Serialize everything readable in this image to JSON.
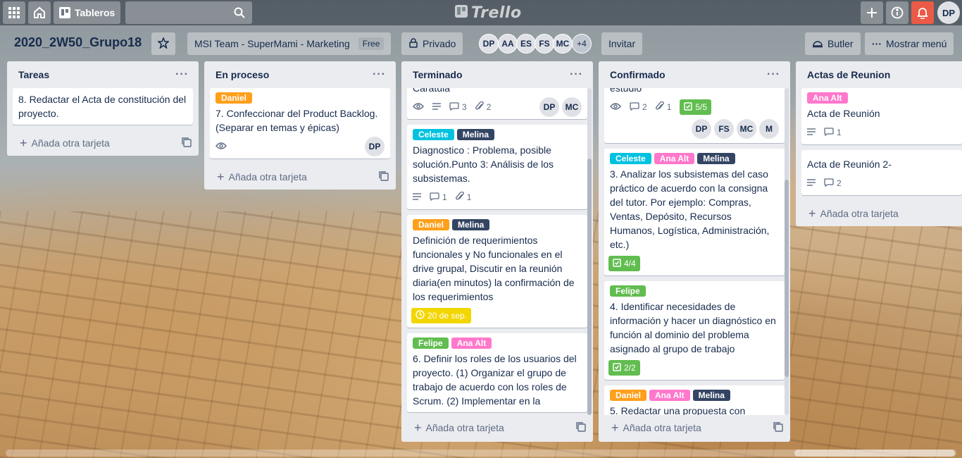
{
  "topbar": {
    "boards_label": "Tableros",
    "logo": "Trello",
    "user_initials": "DP"
  },
  "board": {
    "title": "2020_2W50_Grupo18",
    "team": "MSI Team - SuperMami - Marketing",
    "team_badge": "Free",
    "visibility": "Privado",
    "members": [
      "DP",
      "AA",
      "ES",
      "FS",
      "MC"
    ],
    "members_more": "+4",
    "invite_label": "Invitar",
    "butler_label": "Butler",
    "show_menu_label": "Mostrar menú"
  },
  "label_colors": {
    "Daniel": "#ff9f1a",
    "Celeste": "#00c2e0",
    "Melina": "#344563",
    "Ana Alt": "#ff78cb",
    "Felipe": "#61bd4f"
  },
  "add_card_label": "Añada otra tarjeta",
  "lists": [
    {
      "title": "Tareas",
      "cards": [
        {
          "text": "8. Redactar el Acta de constitución del proyecto."
        }
      ]
    },
    {
      "title": "En proceso",
      "cards": [
        {
          "labels": [
            "Daniel"
          ],
          "text": "7. Confeccionar del Product Backlog. (Separar en temas y épicas)",
          "avatars": [
            "DP"
          ]
        }
      ]
    },
    {
      "title": "Terminado",
      "cards": [
        {
          "text": "Carátula",
          "comments": "3",
          "attachments": "2",
          "avatars": [
            "DP",
            "MC"
          ]
        },
        {
          "labels": [
            "Celeste",
            "Melina"
          ],
          "text": "Diagnostico : Problema, posible solución.Punto 3: Análisis de los subsistemas.",
          "comments": "1",
          "attachments": "1"
        },
        {
          "labels": [
            "Daniel",
            "Melina"
          ],
          "text": "Definición de requerimientos funcionales y No funcionales en el drive grupal, Discutir en la reunión diaria(en minutos) la confirmación de los requerimientos",
          "due": "20 de sep."
        },
        {
          "labels": [
            "Felipe",
            "Ana Alt"
          ],
          "text": "6. Definir los roles de los usuarios del proyecto. (1) Organizar el grupo de trabajo de acuerdo con los roles de Scrum. (2) Implementar en la"
        }
      ]
    },
    {
      "title": "Confirmado",
      "cards": [
        {
          "text": "estudio",
          "comments": "2",
          "attachments": "1",
          "checklist": "5/5",
          "avatars": [
            "DP",
            "FS",
            "MC",
            "M"
          ]
        },
        {
          "labels": [
            "Celeste",
            "Ana Alt",
            "Melina"
          ],
          "text": "3. Analizar los subsistemas del caso práctico de acuerdo con la consigna del tutor. Por ejemplo: Compras, Ventas, Depósito, Recursos Humanos, Logística, Administración, etc.)",
          "checklist": "4/4"
        },
        {
          "labels": [
            "Felipe"
          ],
          "text": "4. Identificar necesidades de información y hacer un diagnóstico en función al dominio del problema asignado al grupo de trabajo",
          "checklist": "2/2"
        },
        {
          "labels": [
            "Daniel",
            "Ana Alt",
            "Melina"
          ],
          "text": "5. Redactar una propuesta con"
        }
      ]
    },
    {
      "title": "Actas de Reunion",
      "cards": [
        {
          "labels": [
            "Ana Alt"
          ],
          "text": "Acta de Reunión",
          "comments": "1"
        },
        {
          "text": "Acta de Reunión 2-",
          "comments": "2"
        }
      ]
    }
  ]
}
